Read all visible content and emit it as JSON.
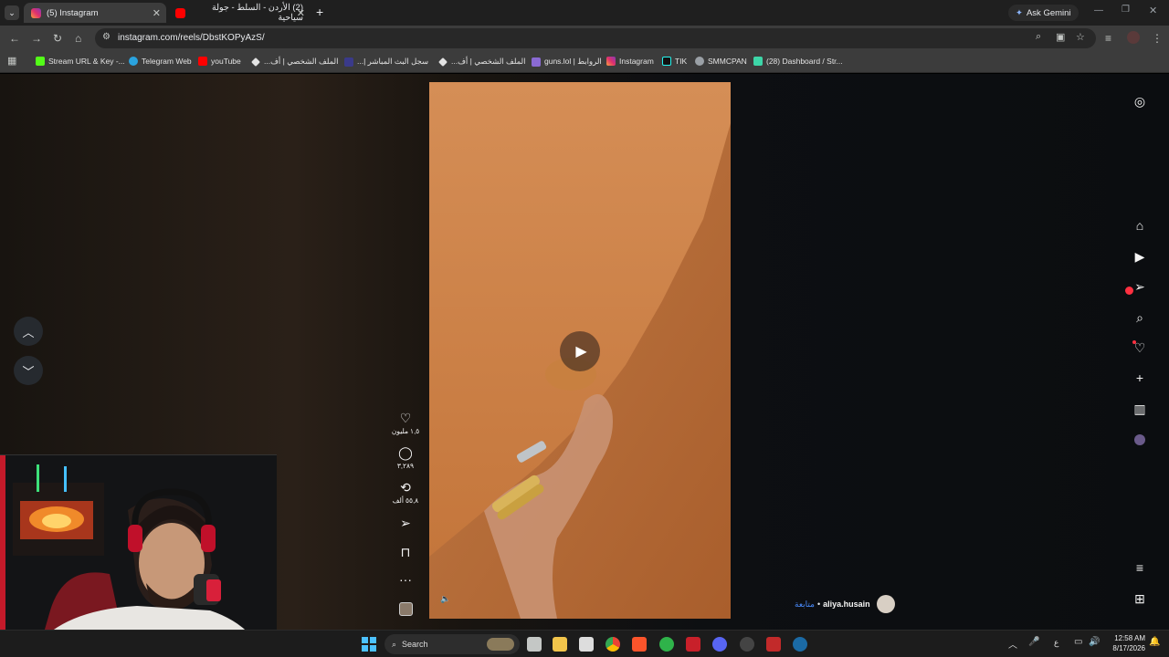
{
  "browser": {
    "tabs": [
      {
        "title": "(5) Instagram",
        "active": true
      },
      {
        "title": "(2) الأردن - السلط - جولة سياحية",
        "active": false
      }
    ],
    "new_tab_symbol": "+",
    "ask_gemini": "Ask Gemini",
    "url": "instagram.com/reels/DbstKOPyAzS/",
    "bookmarks": [
      "Stream URL & Key -...",
      "Telegram Web",
      "youTube",
      "الملف الشخصي | أف...",
      "سجل البث المباشر |...",
      "الملف الشخصي | أف...",
      "guns.lol | الروابط",
      "Instagram",
      "TIK",
      "SMMCPAN",
      "(28) Dashboard / Str..."
    ]
  },
  "reel": {
    "likes": "١,٥ مليون",
    "comments": "٣,٢٨٩",
    "reposts": "٥٥,٨ ألف",
    "author": "aliya.husain",
    "follow_label": "متابعة",
    "separator": "•"
  },
  "taskbar": {
    "search_label": "Search",
    "time": "12:58 AM",
    "date": "8/17/2026",
    "lang": "ع"
  },
  "colors": {
    "page_bg": "#0d0f12",
    "reel_sand": "#c6773e",
    "accent_red": "#ff3040",
    "link_blue": "#4a8cff"
  },
  "icons": [
    "instagram-icon",
    "home-icon",
    "reels-icon",
    "messages-icon",
    "search-icon",
    "notifications-icon",
    "create-icon",
    "dashboard-icon",
    "profile-icon",
    "menu-icon",
    "more-apps-icon",
    "heart-icon",
    "comment-icon",
    "repost-icon",
    "share-icon",
    "bookmark-icon",
    "more-icon",
    "play-icon",
    "mute-icon",
    "chevron-up-icon",
    "chevron-down-icon"
  ]
}
